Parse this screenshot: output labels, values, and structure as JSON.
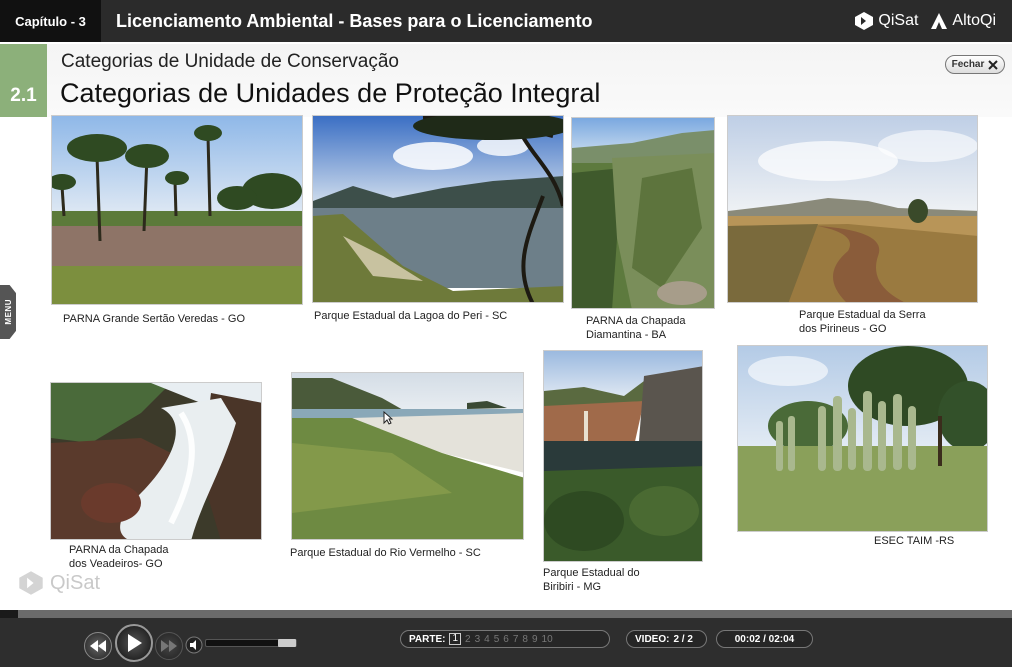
{
  "header": {
    "chapter": "Capítulo - 3",
    "title": "Licenciamento Ambiental - Bases para o Licenciamento",
    "logo_qisat": "QiSat",
    "logo_altoqi": "AltoQi"
  },
  "section": {
    "number": "2.1",
    "subtitle": "Categorias de Unidade de Conservação",
    "title": "Categorias de Unidades de Proteção Integral",
    "close_label": "Fechar"
  },
  "menu_tab": "MENU",
  "photos": [
    {
      "caption_lines": [
        "PARNA Grande Sertão Veredas - GO"
      ]
    },
    {
      "caption_lines": [
        "Parque Estadual da Lagoa do Peri - SC"
      ]
    },
    {
      "caption_lines": [
        "PARNA da Chapada",
        "Diamantina - BA"
      ]
    },
    {
      "caption_lines": [
        "Parque Estadual da Serra",
        "dos Pirineus - GO"
      ]
    },
    {
      "caption_lines": [
        "PARNA da Chapada",
        "dos Veadeiros- GO"
      ]
    },
    {
      "caption_lines": [
        "Parque Estadual do Rio Vermelho - SC"
      ]
    },
    {
      "caption_lines": [
        "Parque Estadual do",
        "Biribiri - MG"
      ]
    },
    {
      "caption_lines": [
        "ESEC TAIM -RS"
      ]
    }
  ],
  "watermark": "QiSat",
  "player": {
    "parts_label": "PARTE:",
    "parts": [
      "1",
      "2",
      "3",
      "4",
      "5",
      "6",
      "7",
      "8",
      "9",
      "10"
    ],
    "active_part": "1",
    "video_label": "VIDEO:",
    "video_value": "2 / 2",
    "time": "00:02 / 02:04"
  }
}
